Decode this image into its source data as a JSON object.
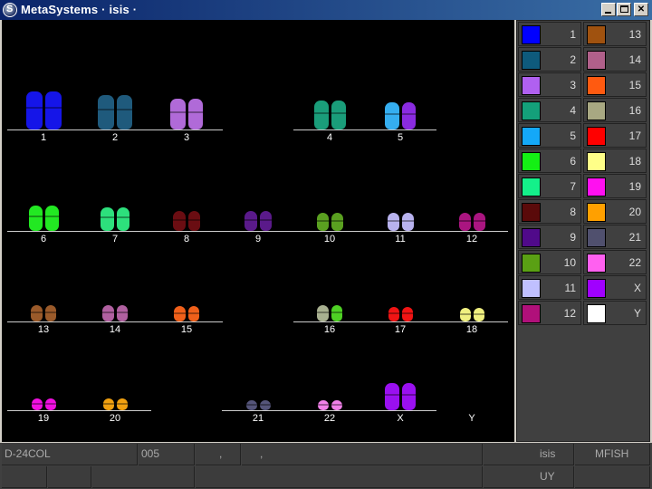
{
  "window": {
    "title": "MetaSystems · isis ·",
    "app_icon_glyph": "S",
    "min_icon": "minimize-icon",
    "max_icon": "maximize-icon",
    "close_icon": "close-icon",
    "close_glyph": "✕"
  },
  "karyogram": {
    "rows": [
      [
        {
          "label": "1",
          "colors": [
            "#1515e8",
            "#1515e8"
          ],
          "h": 42
        },
        {
          "label": "2",
          "colors": [
            "#1f5a7c",
            "#1f5a7c"
          ],
          "h": 38
        },
        {
          "label": "3",
          "colors": [
            "#b06ad8",
            "#b06ad8"
          ],
          "h": 34
        },
        {
          "label": "",
          "colors": [],
          "h": 0
        },
        {
          "label": "4",
          "colors": [
            "#1a9d7a",
            "#1a9d7a"
          ],
          "h": 32
        },
        {
          "label": "5",
          "colors": [
            "#35aef0",
            "#8a2be0"
          ],
          "h": 30
        }
      ],
      [
        {
          "label": "6",
          "colors": [
            "#22e822",
            "#22e822"
          ],
          "h": 28
        },
        {
          "label": "7",
          "colors": [
            "#2de07c",
            "#2de07c"
          ],
          "h": 26
        },
        {
          "label": "8",
          "colors": [
            "#6a0d12",
            "#6a0d12"
          ],
          "h": 22
        },
        {
          "label": "9",
          "colors": [
            "#5a1a8a",
            "#5a1a8a"
          ],
          "h": 22
        },
        {
          "label": "10",
          "colors": [
            "#5aa020",
            "#5aa020"
          ],
          "h": 20
        },
        {
          "label": "11",
          "colors": [
            "#b8b2ee",
            "#b8b2ee"
          ],
          "h": 20
        },
        {
          "label": "12",
          "colors": [
            "#aa1580",
            "#aa1580"
          ],
          "h": 20
        }
      ],
      [
        {
          "label": "13",
          "colors": [
            "#9a5a2a",
            "#9a5a2a"
          ],
          "h": 18
        },
        {
          "label": "14",
          "colors": [
            "#b060a0",
            "#b060a0"
          ],
          "h": 18
        },
        {
          "label": "15",
          "colors": [
            "#f0601a",
            "#f0601a"
          ],
          "h": 17
        },
        {
          "label": "",
          "colors": [],
          "h": 0
        },
        {
          "label": "16",
          "colors": [
            "#a8b090",
            "#4ed024"
          ],
          "h": 18
        },
        {
          "label": "17",
          "colors": [
            "#f01414",
            "#f01414"
          ],
          "h": 16
        },
        {
          "label": "18",
          "colors": [
            "#f0f080",
            "#f0f080"
          ],
          "h": 15
        }
      ],
      [
        {
          "label": "19",
          "colors": [
            "#f010e0",
            "#f010e0"
          ],
          "h": 13
        },
        {
          "label": "20",
          "colors": [
            "#f0a010",
            "#f0a010"
          ],
          "h": 13
        },
        {
          "label": "",
          "colors": [],
          "h": 0
        },
        {
          "label": "21",
          "colors": [
            "#55557a",
            "#55557a"
          ],
          "h": 11
        },
        {
          "label": "22",
          "colors": [
            "#f080e8",
            "#f080e8"
          ],
          "h": 11
        },
        {
          "label": "X",
          "colors": [
            "#9a10f0",
            "#9a10f0"
          ],
          "h": 30
        },
        {
          "label": "Y",
          "colors": [],
          "h": 0
        }
      ]
    ]
  },
  "legend": [
    {
      "num": "1",
      "color": "#0000ff"
    },
    {
      "num": "13",
      "color": "#a0520f"
    },
    {
      "num": "2",
      "color": "#0e5a7c"
    },
    {
      "num": "14",
      "color": "#b0608a"
    },
    {
      "num": "3",
      "color": "#b060f0"
    },
    {
      "num": "15",
      "color": "#ff5a10"
    },
    {
      "num": "4",
      "color": "#14a07a"
    },
    {
      "num": "16",
      "color": "#a8a882"
    },
    {
      "num": "5",
      "color": "#14a8f8"
    },
    {
      "num": "17",
      "color": "#ff0000"
    },
    {
      "num": "6",
      "color": "#14f014"
    },
    {
      "num": "18",
      "color": "#ffff88"
    },
    {
      "num": "7",
      "color": "#14f08a"
    },
    {
      "num": "19",
      "color": "#ff10f0"
    },
    {
      "num": "8",
      "color": "#5a0a0a"
    },
    {
      "num": "20",
      "color": "#ffa000"
    },
    {
      "num": "9",
      "color": "#500a8a"
    },
    {
      "num": "21",
      "color": "#50506e"
    },
    {
      "num": "10",
      "color": "#5aa014"
    },
    {
      "num": "22",
      "color": "#ff60f0"
    },
    {
      "num": "11",
      "color": "#c0c0ff"
    },
    {
      "num": "X",
      "color": "#a000ff"
    },
    {
      "num": "12",
      "color": "#b0107a"
    },
    {
      "num": "Y",
      "color": "#ffffff"
    }
  ],
  "status": {
    "case_id": "D-24COL",
    "slide": "005",
    "field_a": ",",
    "field_b": ",",
    "app": "isis",
    "mode": "MFISH",
    "user": "UY"
  }
}
